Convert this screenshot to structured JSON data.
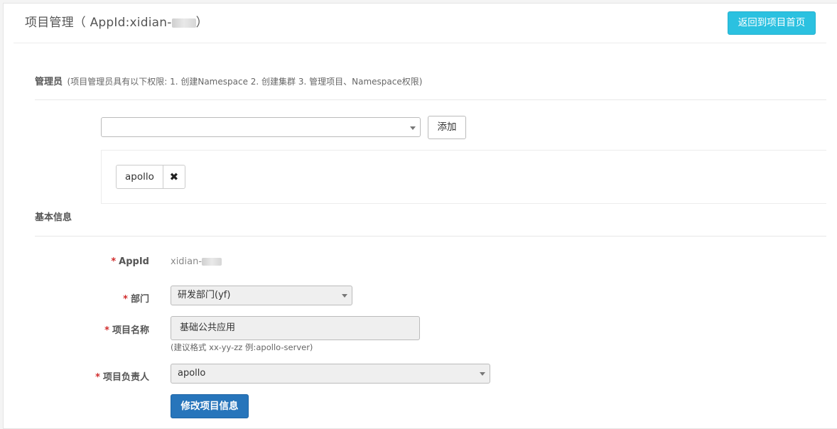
{
  "header": {
    "title_prefix": "项目管理（ AppId:xidian-",
    "title_suffix": "）",
    "back_button": "返回到项目首页"
  },
  "admins": {
    "title": "管理员",
    "note": "(项目管理员具有以下权限: 1. 创建Namespace 2. 创建集群 3. 管理项目、Namespace权限)",
    "search_value": "",
    "add_button": "添加",
    "items": [
      {
        "name": "apollo",
        "remove_icon": "✖"
      }
    ]
  },
  "basic_info": {
    "title": "基本信息",
    "required_mark": "*",
    "appid": {
      "label": "AppId",
      "value": "xidian-"
    },
    "department": {
      "label": "部门",
      "value": "研发部门(yf)"
    },
    "project_name": {
      "label": "项目名称",
      "value": "基础公共应用",
      "hint": "(建议格式 xx-yy-zz 例:apollo-server)"
    },
    "owner": {
      "label": "项目负责人",
      "value": "apollo"
    },
    "save_button": "修改项目信息"
  }
}
